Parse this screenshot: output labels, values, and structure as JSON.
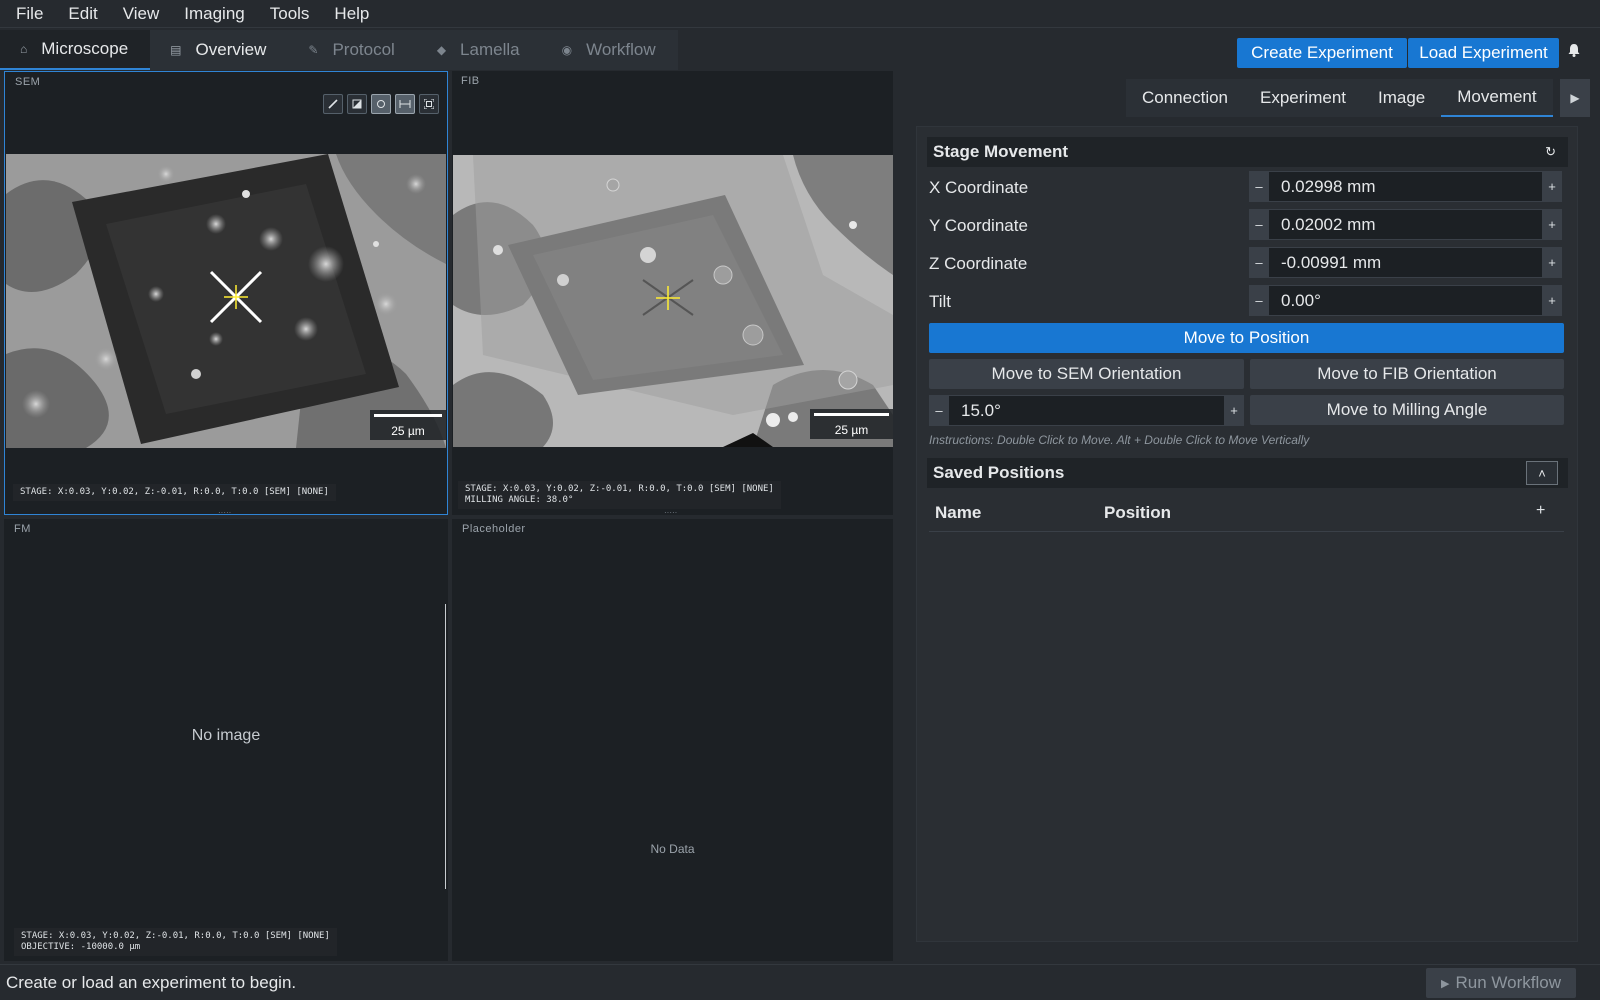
{
  "menu": [
    "File",
    "Edit",
    "View",
    "Imaging",
    "Tools",
    "Help"
  ],
  "tabs": [
    {
      "label": "Microscope",
      "icon": "⌂"
    },
    {
      "label": "Overview",
      "icon": "▤"
    },
    {
      "label": "Protocol",
      "icon": "✎"
    },
    {
      "label": "Lamella",
      "icon": "◆"
    },
    {
      "label": "Workflow",
      "icon": "◉"
    }
  ],
  "header": {
    "create_label": "Create Experiment",
    "load_label": "Load Experiment",
    "bell_icon": "🔔"
  },
  "viewers": {
    "sem": {
      "label": "SEM",
      "scale": "25 µm",
      "info_line1": "STAGE: X:0.03, Y:0.02, Z:-0.01, R:0.0, T:0.0 [SEM] [NONE]"
    },
    "fib": {
      "label": "FIB",
      "scale": "25 µm",
      "info_line1": "STAGE: X:0.03, Y:0.02, Z:-0.01, R:0.0, T:0.0 [SEM] [NONE]",
      "info_line2": "MILLING ANGLE: 38.0°"
    },
    "fm": {
      "label": "FM",
      "empty_text": "No image",
      "info_line1": "STAGE: X:0.03, Y:0.02, Z:-0.01, R:0.0, T:0.0 [SEM] [NONE]",
      "info_line2": "OBJECTIVE: -10000.0 µm"
    },
    "placeholder": {
      "label": "Placeholder",
      "empty_text": "No Data"
    }
  },
  "sem_tools": [
    "✎",
    "▨",
    "○",
    "⟷",
    "⌖"
  ],
  "right_tabs": [
    "Connection",
    "Experiment",
    "Image",
    "Movement"
  ],
  "right_arrow": "▶",
  "stage": {
    "title": "Stage Movement",
    "refresh_icon": "↻",
    "rows": [
      {
        "label": "X Coordinate",
        "value": "0.02998 mm"
      },
      {
        "label": "Y Coordinate",
        "value": "0.02002 mm"
      },
      {
        "label": "Z Coordinate",
        "value": "-0.00991 mm"
      },
      {
        "label": "Tilt",
        "value": "0.00°"
      }
    ],
    "move_position": "Move to Position",
    "move_sem": "Move to SEM Orientation",
    "move_fib": "Move to FIB Orientation",
    "milling_value": "15.0°",
    "move_milling": "Move to Milling Angle",
    "instructions": "Instructions: Double Click to Move. Alt + Double Click to Move Vertically",
    "minus": "–",
    "plus": "+"
  },
  "saved": {
    "title": "Saved Positions",
    "collapse_icon": "˄",
    "col_name": "Name",
    "col_position": "Position",
    "add_icon": "+"
  },
  "status": {
    "text": "Create or load an experiment to begin.",
    "run_label": "Run Workflow",
    "run_icon": "▶"
  }
}
